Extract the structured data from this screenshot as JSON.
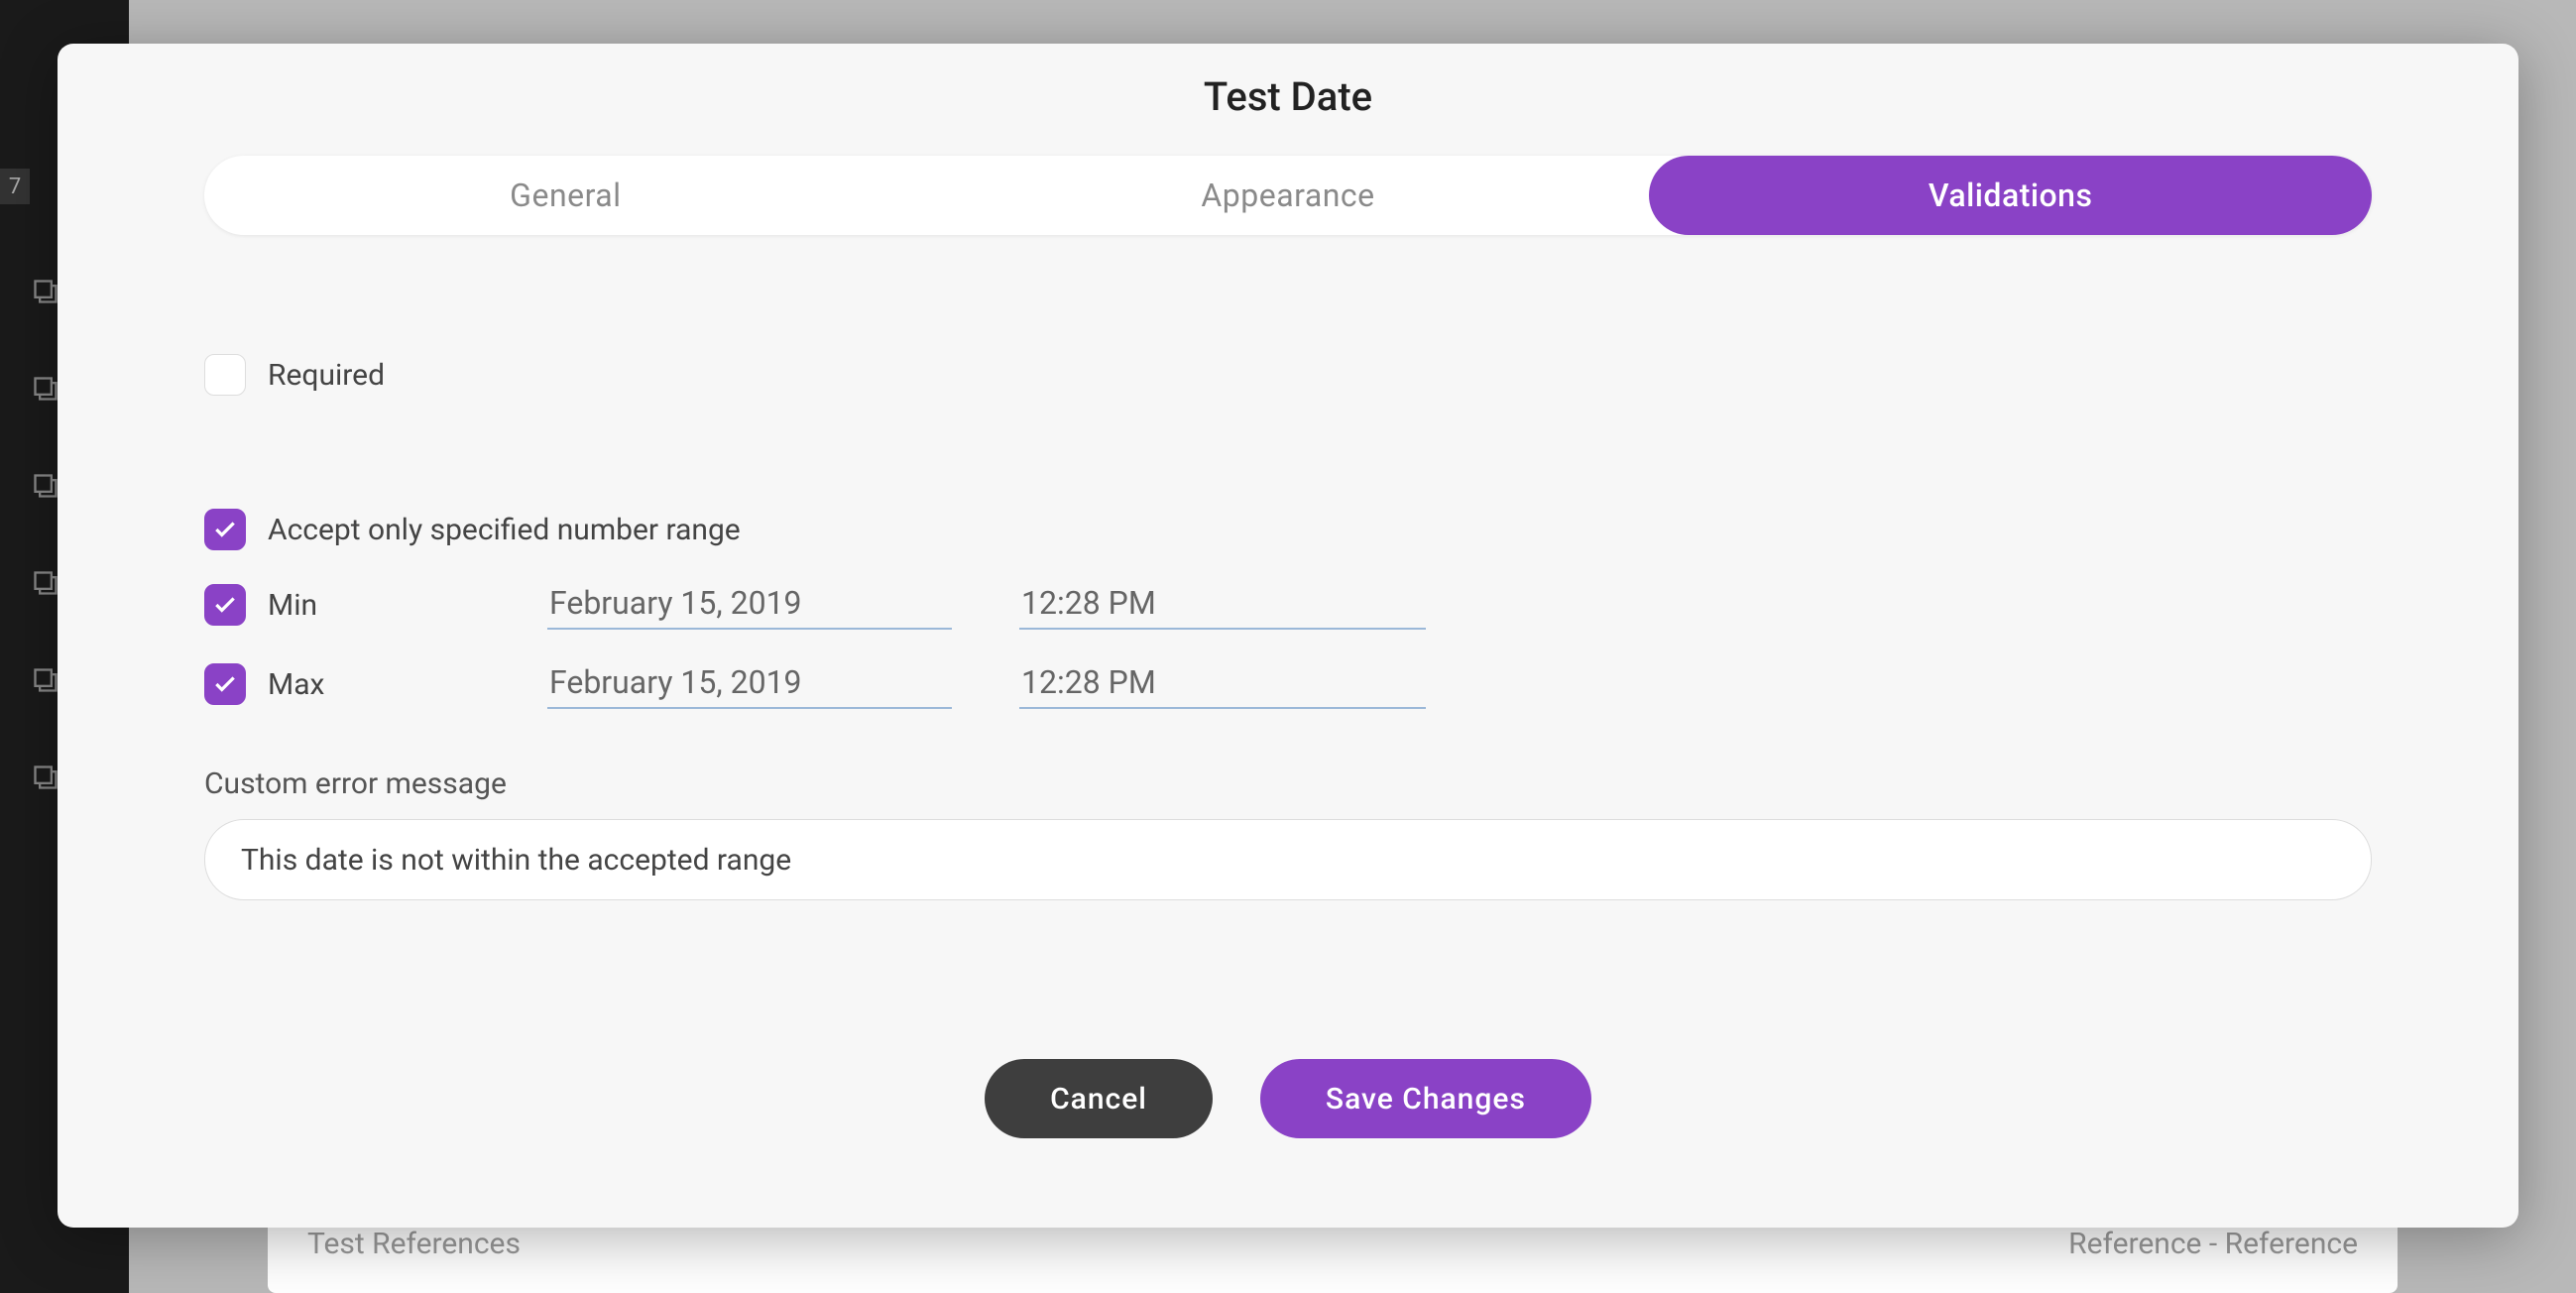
{
  "background": {
    "sidebar_badge": "7",
    "card_left": "Test References",
    "card_right": "Reference - Reference"
  },
  "modal": {
    "title": "Test Date",
    "tabs": {
      "general": "General",
      "appearance": "Appearance",
      "validations": "Validations"
    },
    "validations": {
      "required_label": "Required",
      "required_checked": false,
      "range_label": "Accept only specified number range",
      "range_checked": true,
      "min_label": "Min",
      "min_checked": true,
      "min_date": "February 15, 2019",
      "min_time": "12:28 PM",
      "max_label": "Max",
      "max_checked": true,
      "max_date": "February 15, 2019",
      "max_time": "12:28 PM",
      "custom_error_label": "Custom error message",
      "custom_error_value": "This date is not within the accepted range"
    },
    "actions": {
      "cancel": "Cancel",
      "save": "Save Changes"
    }
  },
  "colors": {
    "accent": "#8a42c6",
    "underline": "#9bb8d8"
  }
}
